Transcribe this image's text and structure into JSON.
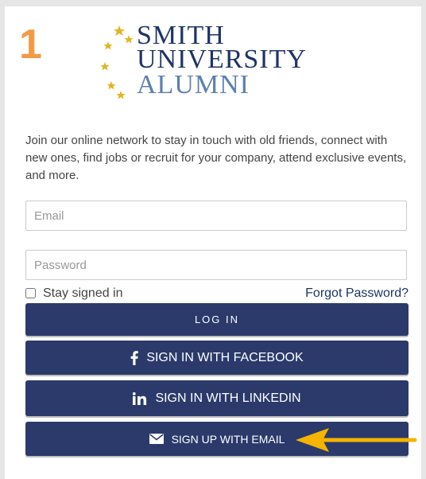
{
  "step_number": "1",
  "logo": {
    "line1": "SMITH",
    "line2": "UNIVERSITY",
    "line3": "ALUMNI",
    "star_color": "#e2b423",
    "primary_color": "#1d3466",
    "secondary_color": "#5d7fb0"
  },
  "intro_text": "Join our online network to stay in touch with old friends, connect with new ones, find jobs or recruit for your company, attend exclusive events, and more.",
  "form": {
    "email_placeholder": "Email",
    "password_placeholder": "Password",
    "stay_signed_in_label": "Stay signed in",
    "stay_signed_in_checked": false,
    "forgot_password_label": "Forgot Password?"
  },
  "buttons": {
    "login_label": "LOG IN",
    "facebook_label": "SIGN IN WITH FACEBOOK",
    "linkedin_label": "SIGN IN WITH LINKEDIN",
    "email_label": "SIGN UP WITH EMAIL",
    "facebook_icon": "facebook-icon",
    "linkedin_icon": "linkedin-icon",
    "email_icon": "envelope-icon"
  },
  "colors": {
    "button_bg": "#2b3a6b",
    "step_number": "#f39a47",
    "arrow": "#f5b400"
  },
  "annotation": {
    "arrow_icon": "arrow-left-icon"
  }
}
